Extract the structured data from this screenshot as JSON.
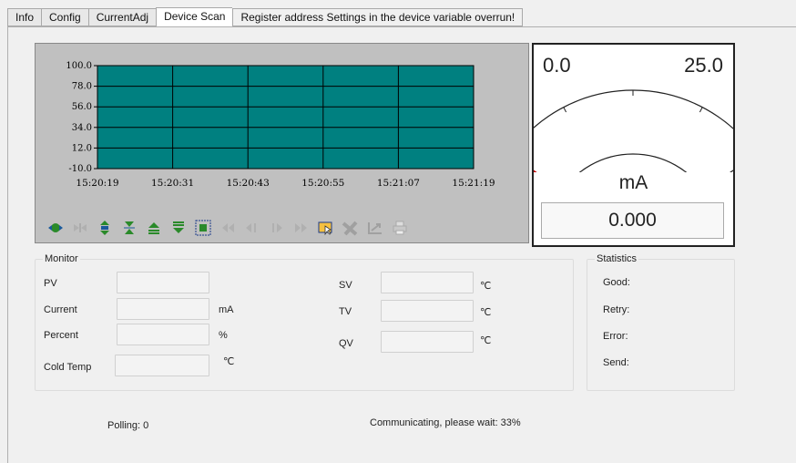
{
  "tabs": [
    {
      "label": "Info"
    },
    {
      "label": "Config"
    },
    {
      "label": "CurrentAdj"
    },
    {
      "label": "Device Scan",
      "active": true
    }
  ],
  "message": "Register address Settings in the device variable overrun!",
  "chart_data": {
    "type": "line",
    "y_ticks": [
      "100.0",
      "78.0",
      "56.0",
      "34.0",
      "12.0",
      "-10.0"
    ],
    "x_ticks": [
      "15:20:19",
      "15:20:31",
      "15:20:43",
      "15:20:55",
      "15:21:07",
      "15:21:19"
    ],
    "ylim": [
      -10.0,
      100.0
    ],
    "grid": true,
    "background": "#008080",
    "series": []
  },
  "toolbar": {
    "icons": [
      "zoom-fit-x-icon",
      "zoom-in-x-icon",
      "zoom-fit-y-icon",
      "zoom-in-y-icon",
      "scroll-up-icon",
      "scroll-down-icon",
      "zoom-box-icon",
      "first-page-icon",
      "prev-page-icon",
      "next-page-icon",
      "last-page-icon",
      "cursor-icon",
      "tools-icon",
      "export-icon",
      "print-icon"
    ]
  },
  "gauge": {
    "min": "0.0",
    "max": "25.0",
    "unit": "mA",
    "value": "0.000",
    "level": 0.0,
    "needle_color": "#c00000"
  },
  "monitor": {
    "title": "Monitor",
    "pv_label": "PV",
    "current_label": "Current",
    "current_unit": "mA",
    "percent_label": "Percent",
    "percent_unit": "%",
    "cold_temp_label": "Cold Temp",
    "cold_temp_unit": "℃",
    "sv_label": "SV",
    "sv_unit": "℃",
    "tv_label": "TV",
    "tv_unit": "℃",
    "qv_label": "QV",
    "qv_unit": "℃"
  },
  "statistics": {
    "title": "Statistics",
    "good": "Good:",
    "retry": "Retry:",
    "error": "Error:",
    "send": "Send:"
  },
  "status": {
    "polling": "Polling:  0",
    "communicating": "Communicating, please wait:  33%"
  }
}
